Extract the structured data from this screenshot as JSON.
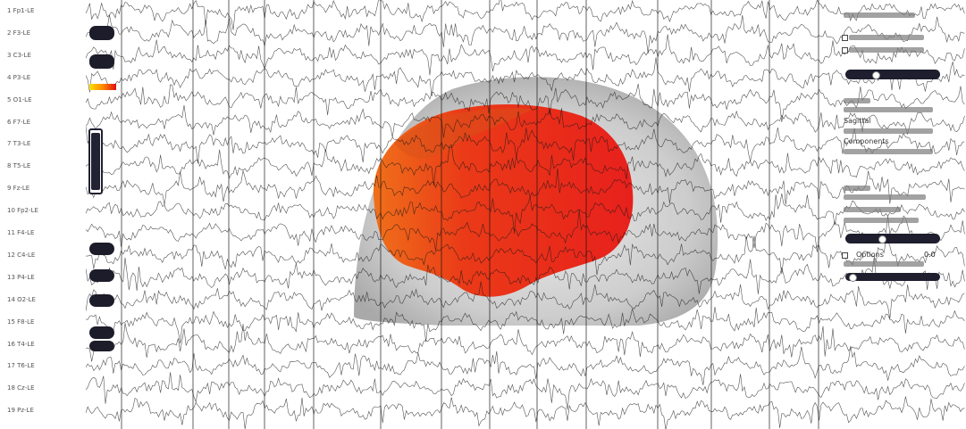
{
  "channels": [
    {
      "label": "1 Fp1-LE"
    },
    {
      "label": "2 F3-LE"
    },
    {
      "label": "3 C3-LE"
    },
    {
      "label": "4 P3-LE"
    },
    {
      "label": "5 O1-LE"
    },
    {
      "label": "6 F7-LE"
    },
    {
      "label": "7 T3-LE"
    },
    {
      "label": "8 T5-LE"
    },
    {
      "label": "9 Fz-LE"
    },
    {
      "label": "10 Fp2-LE"
    },
    {
      "label": "11 F4-LE"
    },
    {
      "label": "12 C4-LE"
    },
    {
      "label": "13 P4-LE"
    },
    {
      "label": "14 O2-LE"
    },
    {
      "label": "15 F8-LE"
    },
    {
      "label": "16 T4-LE"
    },
    {
      "label": "17 T6-LE"
    },
    {
      "label": "18 Cz-LE"
    },
    {
      "label": "19 Pz-LE"
    }
  ],
  "controls": {
    "sliders": [
      {
        "name": "top-slider",
        "value": 0.3
      },
      {
        "name": "middle-slider",
        "value": 0.35
      },
      {
        "name": "bottom-slider",
        "value": 0.05
      }
    ],
    "headings": [
      "Sagittal",
      "Components"
    ],
    "options_label": "Options",
    "value_readout": "0.0"
  },
  "colors": {
    "wave": "#1a1a1a",
    "head": "#c8c8c8",
    "brain_red": "#e8281c",
    "brain_orange": "#f06a14",
    "slider": "#1e1e2e"
  }
}
